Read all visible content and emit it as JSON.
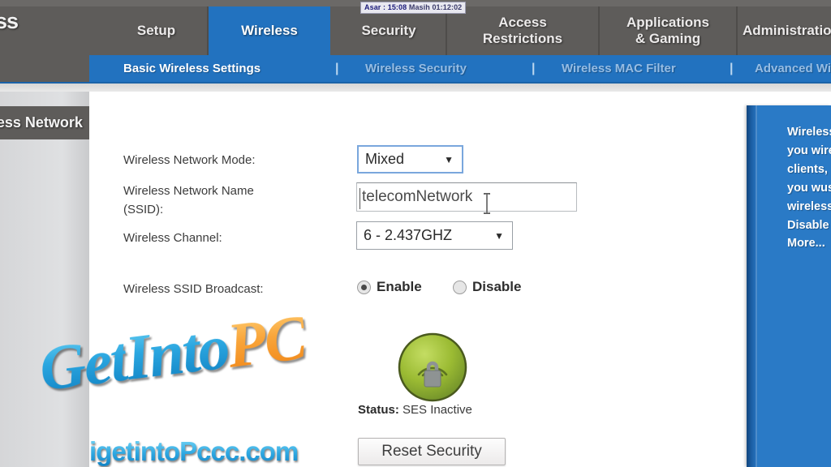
{
  "window": {
    "brand_fragment": "ss"
  },
  "tooltip": {
    "prefix": "Asar : 15:08",
    "suffix": "Masih 01:12:02"
  },
  "topnav": {
    "items": [
      {
        "label": "Setup",
        "active": false
      },
      {
        "label": "Wireless",
        "active": true
      },
      {
        "label": "Security",
        "active": false
      },
      {
        "label": "Access Restrictions",
        "active": false
      },
      {
        "label": "Applications & Gaming",
        "active": false
      },
      {
        "label": "Administration",
        "active": false
      }
    ],
    "setup": "Setup",
    "wireless": "Wireless",
    "security": "Security",
    "access_line1": "Access",
    "access_line2": "Restrictions",
    "apps_line1": "Applications",
    "apps_line2": "& Gaming",
    "administration": "Administration"
  },
  "subnav": {
    "items": [
      {
        "label": "Basic Wireless Settings",
        "active": true
      },
      {
        "label": "Wireless Security",
        "active": false
      },
      {
        "label": "Wireless MAC Filter",
        "active": false
      },
      {
        "label": "Advanced Wireless Settings",
        "active": false
      }
    ],
    "basic": "Basic Wireless Settings",
    "security": "Wireless Security",
    "macfilter": "Wireless MAC Filter",
    "advanced": "Advanced Wireless Settings",
    "separator": "|"
  },
  "left_tab": {
    "label": "Wireless Network"
  },
  "form": {
    "mode_label": "Wireless Network Mode:",
    "mode_value": "Mixed",
    "ssid_label_line1": "Wireless Network Name",
    "ssid_label_line2": "(SSID):",
    "ssid_value": "telecomNetwork",
    "channel_label": "Wireless Channel:",
    "channel_value": "6 - 2.437GHZ",
    "broadcast_label": "Wireless SSID Broadcast:",
    "broadcast_enable": "Enable",
    "broadcast_disable": "Disable",
    "broadcast_selected": "Enable"
  },
  "ses": {
    "status_prefix": "Status:",
    "status_value": "SES Inactive",
    "reset_button": "Reset Security",
    "icon_color": "#9bbb33"
  },
  "help_panel": {
    "lines": [
      "Wireless Network Mode: If",
      "you wireless network has both",
      "clients, in which case ensure",
      "you wust keep the default",
      "wireless network mode.",
      "Disable the wireless",
      "More..."
    ]
  },
  "watermark": {
    "part1": "Get",
    "part2": "Into",
    "part3": "PC",
    "site": "igetintoPccc.com"
  },
  "colors": {
    "accent_blue": "#2272bf",
    "nav_gray": "#5e5c5a",
    "panel_blue": "#2a7ac6",
    "ses_green": "#9bbb33"
  }
}
